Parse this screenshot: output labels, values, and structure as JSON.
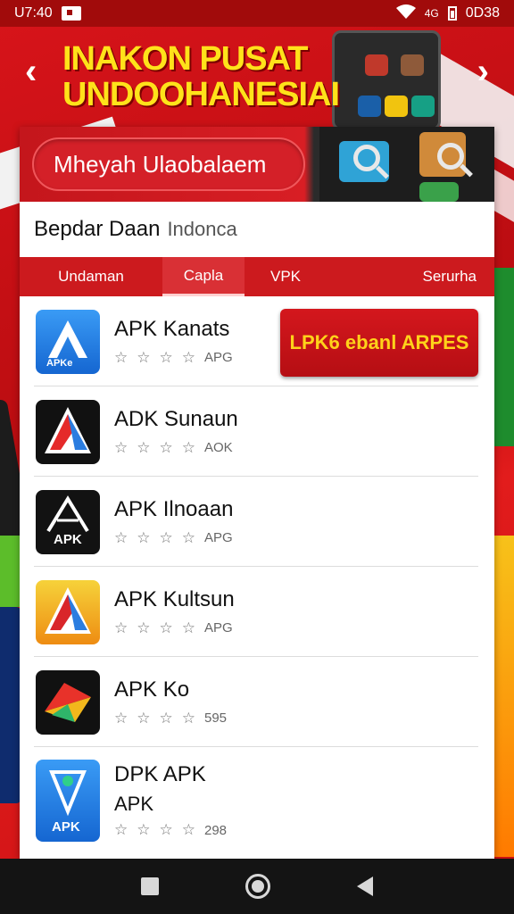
{
  "status_bar": {
    "time": "U7:40",
    "right_text": "0D38",
    "network_label": "4G"
  },
  "banner": {
    "title_line1": "INAKON PUSAT",
    "title_line2": "UNDOOHANESIAI"
  },
  "card": {
    "search_label": "Mheyah Ulaobalaem",
    "section_title": "Bepdar Daan",
    "section_subtitle": "Indonca",
    "tabs": [
      "Undaman",
      "Capla",
      "VPK",
      "Serurha"
    ],
    "promo_label": "LPK6 ebanl ARPES",
    "apps": [
      {
        "name": "APK Kanats",
        "meta": "APG",
        "icon_text": "APKe",
        "icon_colors": [
          "#2e8cf0",
          "#1566d1"
        ]
      },
      {
        "name": "ADK Sunaun",
        "meta": "AOK",
        "icon_text": "",
        "icon_colors": [
          "#111111",
          "#111111"
        ]
      },
      {
        "name": "APK Ilnoaan",
        "meta": "APG",
        "icon_text": "APK",
        "icon_colors": [
          "#111111",
          "#111111"
        ]
      },
      {
        "name": "APK Kultsun",
        "meta": "APG",
        "icon_text": "",
        "icon_colors": [
          "#f3c524",
          "#ee8c12"
        ]
      },
      {
        "name": "APK Ko",
        "meta": "595",
        "icon_text": "",
        "icon_colors": [
          "#111111",
          "#111111"
        ]
      },
      {
        "name": "DPK APK",
        "name2": "APK",
        "meta": "298",
        "icon_text": "APK",
        "icon_colors": [
          "#2e8cf0",
          "#1566d1"
        ]
      }
    ]
  },
  "colors": {
    "brand_red": "#cc1a1e",
    "banner_yellow": "#ffe21a"
  }
}
